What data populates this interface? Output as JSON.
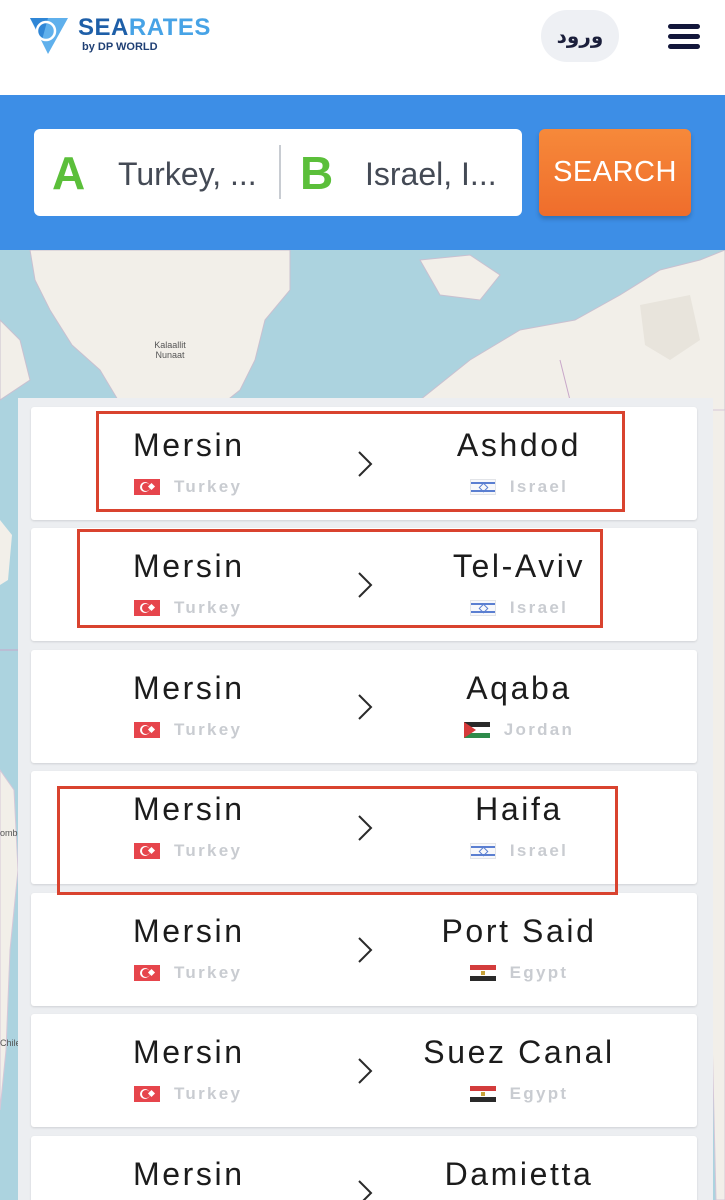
{
  "header": {
    "brand_sea": "SEA",
    "brand_rates": "RATES",
    "brand_sub": "by DP WORLD",
    "login_label": "ورود"
  },
  "search": {
    "from_letter": "A",
    "from_value": "Turkey, ...",
    "to_letter": "B",
    "to_value": "Israel, I...",
    "button_label": "SEARCH"
  },
  "map": {
    "labels": [
      "Kalaallit Nunaat",
      "omb",
      "Chile"
    ]
  },
  "routes": [
    {
      "from_city": "Mersin",
      "from_country": "Turkey",
      "from_flag": "turkey-flag-icon",
      "to_city": "Ashdod",
      "to_country": "Israel",
      "to_flag": "israel-flag-icon",
      "highlighted": true
    },
    {
      "from_city": "Mersin",
      "from_country": "Turkey",
      "from_flag": "turkey-flag-icon",
      "to_city": "Tel-Aviv",
      "to_country": "Israel",
      "to_flag": "israel-flag-icon",
      "highlighted": true
    },
    {
      "from_city": "Mersin",
      "from_country": "Turkey",
      "from_flag": "turkey-flag-icon",
      "to_city": "Aqaba",
      "to_country": "Jordan",
      "to_flag": "jordan-flag-icon",
      "highlighted": false
    },
    {
      "from_city": "Mersin",
      "from_country": "Turkey",
      "from_flag": "turkey-flag-icon",
      "to_city": "Haifa",
      "to_country": "Israel",
      "to_flag": "israel-flag-icon",
      "highlighted": true
    },
    {
      "from_city": "Mersin",
      "from_country": "Turkey",
      "from_flag": "turkey-flag-icon",
      "to_city": "Port Said",
      "to_country": "Egypt",
      "to_flag": "egypt-flag-icon",
      "highlighted": false
    },
    {
      "from_city": "Mersin",
      "from_country": "Turkey",
      "from_flag": "turkey-flag-icon",
      "to_city": "Suez Canal",
      "to_country": "Egypt",
      "to_flag": "egypt-flag-icon",
      "highlighted": false
    },
    {
      "from_city": "Mersin",
      "from_country": "Turkey",
      "from_flag": "turkey-flag-icon",
      "to_city": "Damietta",
      "to_country": "",
      "to_flag": "",
      "highlighted": false
    }
  ],
  "colors": {
    "brand_blue": "#3d8ee6",
    "search_orange": "#ef6d2c",
    "letter_green": "#5bbf3a",
    "highlight_red": "#d9432f",
    "map_water": "#acd3df"
  }
}
